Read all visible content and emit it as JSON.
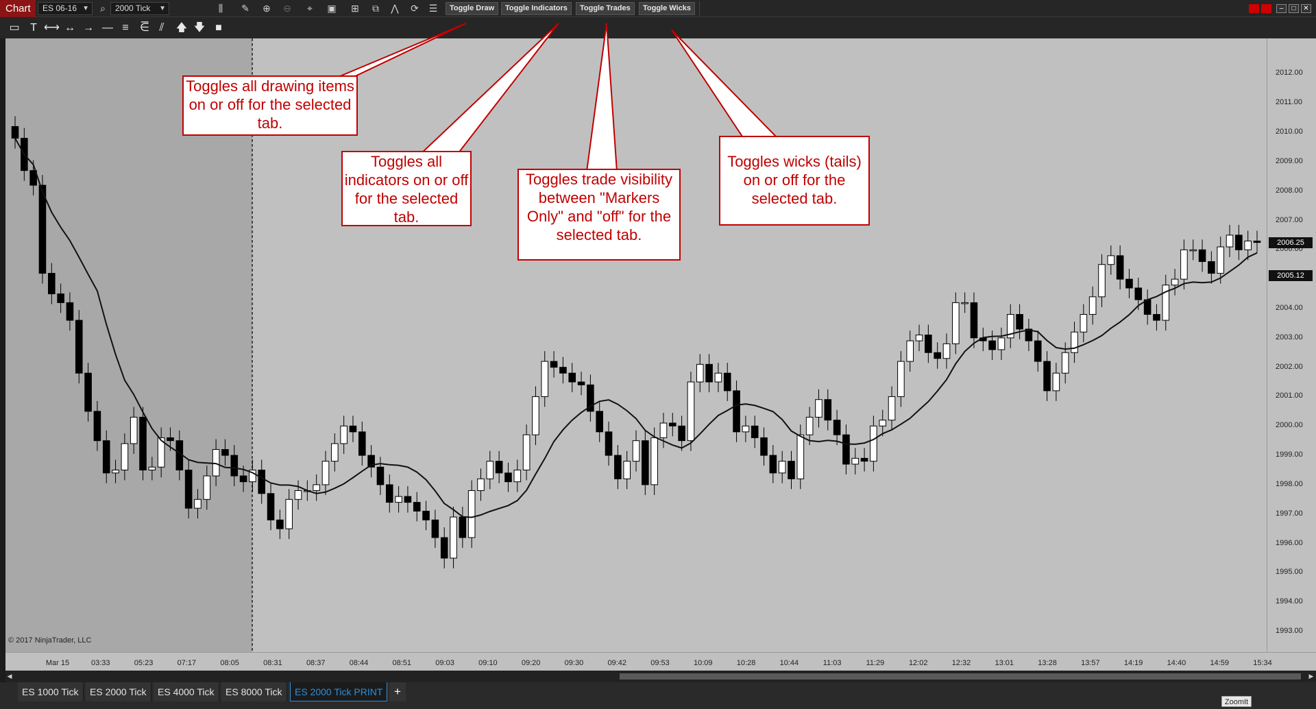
{
  "toolbar": {
    "chart_label": "Chart",
    "instrument": "ES 06-16",
    "period": "2000 Tick",
    "buttons": {
      "toggle_draw": "Toggle Draw",
      "toggle_indicators": "Toggle Indicators",
      "toggle_trades": "Toggle Trades",
      "toggle_wicks": "Toggle Wicks"
    }
  },
  "callouts": {
    "draw": "Toggles all drawing items on or off for the selected tab.",
    "indicators": "Toggles all indicators on or off for the selected tab.",
    "trades": "Toggles trade visibility between \"Markers Only\" and \"off\" for the selected tab.",
    "wicks": "Toggles wicks (tails) on or off for the selected tab."
  },
  "copyright": "© 2017 NinjaTrader, LLC",
  "tabs": [
    "ES 1000 Tick",
    "ES 2000 Tick",
    "ES 4000 Tick",
    "ES 8000 Tick",
    "ES 2000 Tick PRINT"
  ],
  "active_tab": "ES 2000 Tick PRINT",
  "zoomit_label": "ZoomIt",
  "colors": {
    "accent": "#c00000",
    "plot_bg": "#c0c0c0",
    "session_shade": "#a8a8a8",
    "up_candle": "#ffffff",
    "down_candle": "#000000",
    "active_tab": "#2e8fd9"
  },
  "chart_data": {
    "type": "candlestick",
    "instrument": "ES 06-16",
    "period": "2000 Tick",
    "y_ticks": [
      "2012.00",
      "2011.00",
      "2010.00",
      "2009.00",
      "2008.00",
      "2007.00",
      "2006.00",
      "2005.00",
      "2004.00",
      "2003.00",
      "2002.00",
      "2001.00",
      "2000.00",
      "1999.00",
      "1998.00",
      "1997.00",
      "1996.00",
      "1995.00",
      "1994.00",
      "1993.00"
    ],
    "ylim": [
      1992.3,
      2013.2
    ],
    "x_ticks": [
      "Mar 15",
      "03:33",
      "05:23",
      "07:17",
      "08:05",
      "08:31",
      "08:37",
      "08:44",
      "08:51",
      "09:03",
      "09:10",
      "09:20",
      "09:30",
      "09:42",
      "09:53",
      "10:09",
      "10:28",
      "10:44",
      "11:03",
      "11:29",
      "12:02",
      "12:32",
      "13:01",
      "13:28",
      "13:57",
      "14:19",
      "14:40",
      "14:59",
      "15:34"
    ],
    "price_markers": {
      "last": "2006.25",
      "ma": "2005.12"
    },
    "closes": [
      2009.8,
      2008.7,
      2008.2,
      2005.2,
      2004.5,
      2004.2,
      2003.6,
      2001.8,
      2000.5,
      1999.5,
      1998.4,
      1998.5,
      1999.4,
      2000.3,
      1998.5,
      1998.6,
      1999.6,
      1999.5,
      1998.5,
      1997.2,
      1997.5,
      1998.3,
      1999.2,
      1999.0,
      1998.3,
      1998.1,
      1998.5,
      1997.7,
      1996.8,
      1996.5,
      1997.5,
      1997.8,
      1997.8,
      1998.0,
      1998.8,
      1999.4,
      2000.0,
      1999.8,
      1999.0,
      1998.6,
      1998.0,
      1997.4,
      1997.6,
      1997.4,
      1997.1,
      1996.8,
      1996.2,
      1995.5,
      1996.9,
      1996.2,
      1997.8,
      1998.2,
      1998.8,
      1998.4,
      1998.1,
      1998.5,
      1999.7,
      2001.0,
      2002.2,
      2002.0,
      2001.8,
      2001.5,
      2001.4,
      2000.5,
      1999.8,
      1999.0,
      1998.2,
      1998.8,
      1999.5,
      1998.0,
      1999.6,
      2000.1,
      2000.0,
      1999.5,
      2001.5,
      2002.1,
      2001.5,
      2001.8,
      2001.2,
      1999.8,
      2000.0,
      1999.6,
      1999.0,
      1998.4,
      1998.8,
      1998.2,
      1999.7,
      2000.3,
      2000.9,
      2000.2,
      1999.7,
      1998.7,
      1998.9,
      1998.8,
      2000.0,
      2000.2,
      2001.0,
      2002.2,
      2002.9,
      2003.1,
      2002.5,
      2002.3,
      2002.8,
      2004.2,
      2004.2,
      2003.0,
      2002.9,
      2002.6,
      2003.0,
      2003.8,
      2003.3,
      2002.9,
      2002.2,
      2001.2,
      2001.8,
      2002.5,
      2003.2,
      2003.8,
      2004.4,
      2005.5,
      2005.8,
      2005.0,
      2004.7,
      2004.3,
      2003.8,
      2003.6,
      2004.8,
      2005.0,
      2006.0,
      2006.0,
      2005.6,
      2005.2,
      2006.1,
      2006.5,
      2006.0,
      2006.3,
      2006.25
    ]
  }
}
